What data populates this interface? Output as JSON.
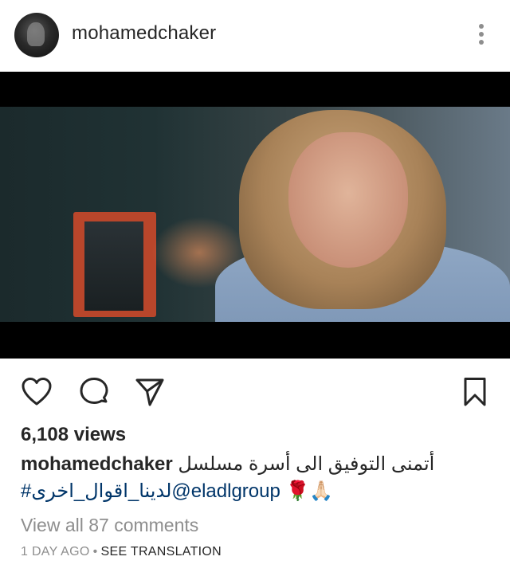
{
  "post": {
    "username": "mohamedchaker",
    "views": "6,108 views",
    "caption_user": "mohamedchaker",
    "caption_text": "أتمنى التوفيق الى أسرة مسلسل",
    "caption_line2": "#لدينا_اقوال_اخرى@eladlgroup 🌹🙏🏻",
    "view_comments": "View all 87 comments",
    "time_ago": "1 DAY AGO",
    "separator": "•",
    "see_translation": "SEE TRANSLATION"
  },
  "icons": {
    "avatar": "profile-avatar",
    "more": "more-vertical-icon",
    "like": "heart-icon",
    "comment": "comment-icon",
    "share": "send-icon",
    "save": "bookmark-icon"
  },
  "colors": {
    "text": "#262626",
    "secondary": "#8e8e8e",
    "link": "#003569",
    "background": "#ffffff",
    "media_bg": "#000000"
  }
}
